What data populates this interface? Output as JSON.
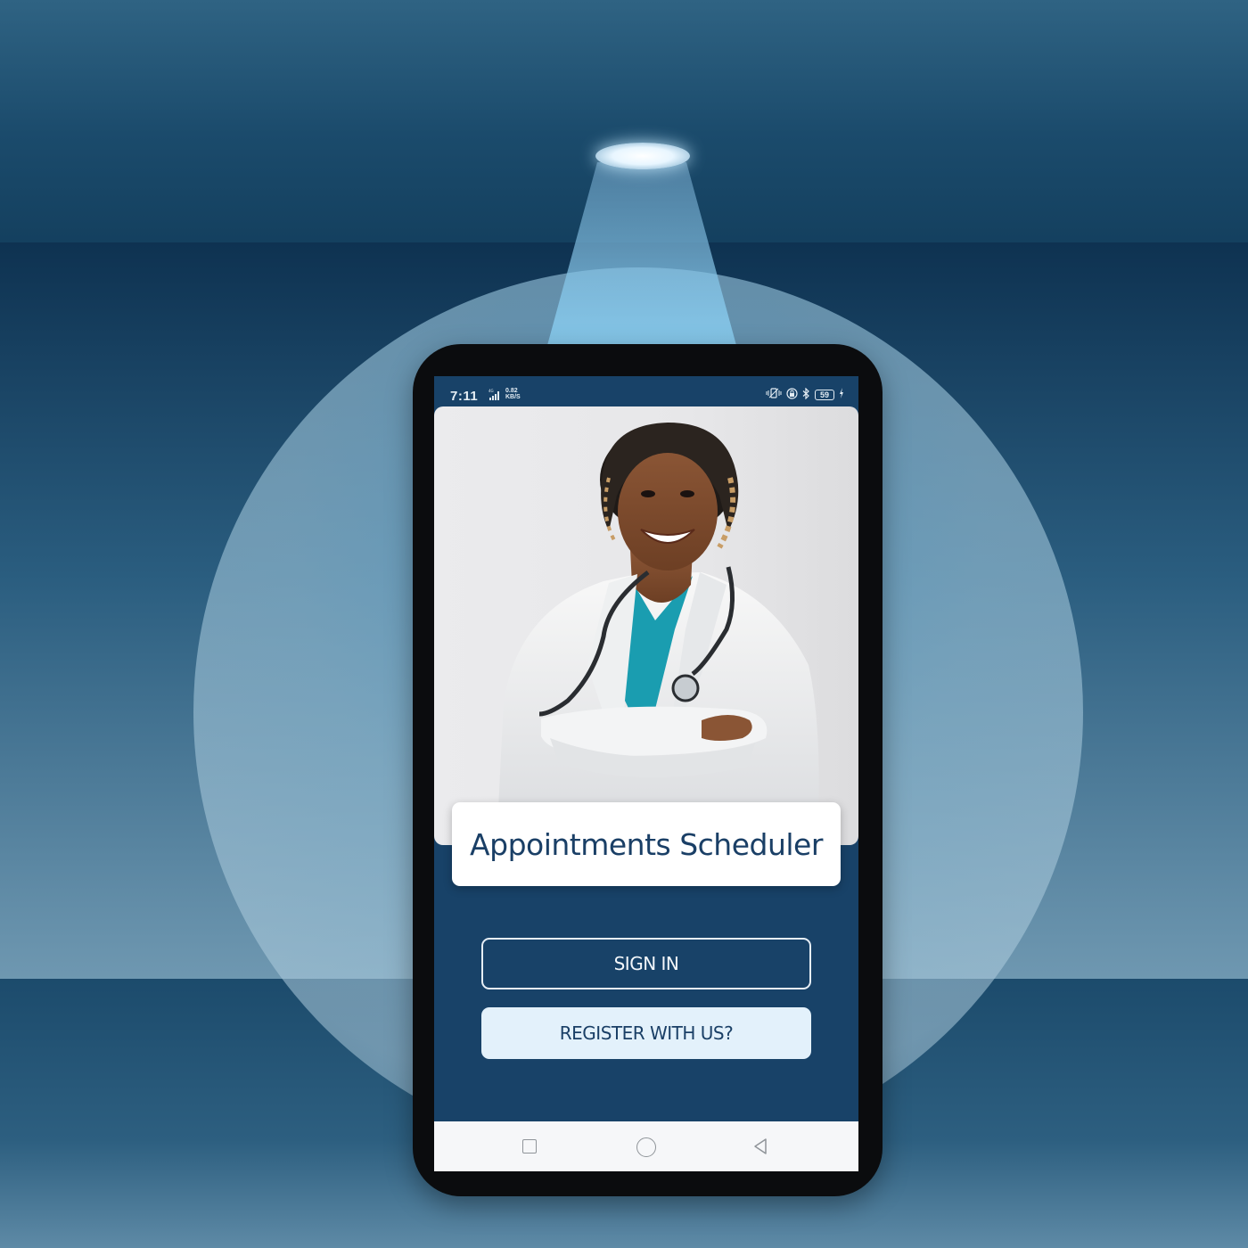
{
  "status_bar": {
    "time": "7:11",
    "network_label": "4G",
    "speed_value": "0.82",
    "speed_unit": "KB/S",
    "battery": "59",
    "icons": [
      "vibrate-icon",
      "sync-lock-icon",
      "bluetooth-icon",
      "battery-icon",
      "charging-icon"
    ]
  },
  "app": {
    "title": "Appointments Scheduler",
    "hero_image": "doctor-portrait"
  },
  "buttons": {
    "sign_in": "SIGN IN",
    "register": "REGISTER WITH US?"
  },
  "nav_bar": {
    "items": [
      "recent-apps-icon",
      "home-icon",
      "back-icon"
    ]
  },
  "colors": {
    "screen_background": "#184268",
    "title_text": "#1a3f66",
    "register_button": "#e3f1fb",
    "phone_frame": "#0b0c0e"
  }
}
